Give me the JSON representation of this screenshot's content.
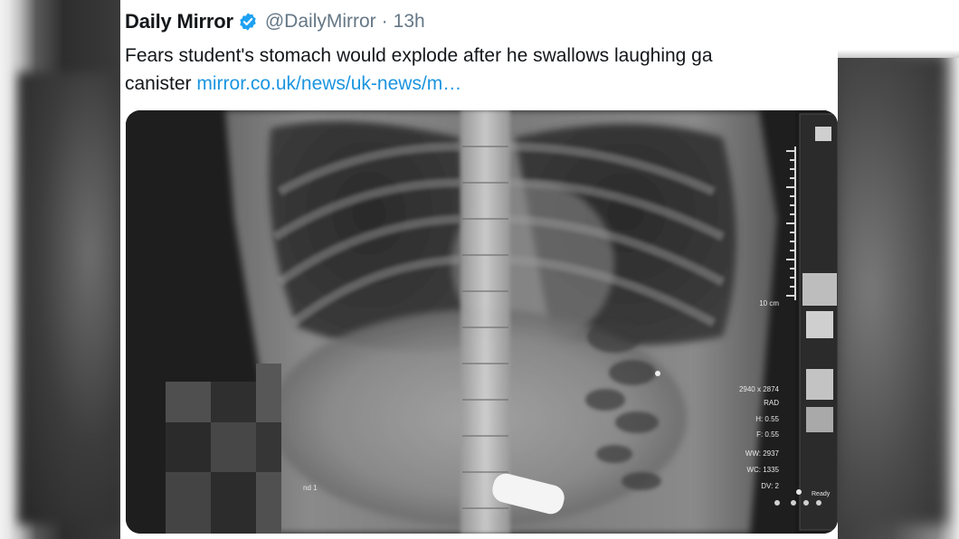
{
  "tweet": {
    "display_name": "Daily Mirror",
    "handle": "@DailyMirror",
    "separator": "·",
    "time": "13h",
    "text_line1": "Fears student's stomach would explode after he swallows laughing ga",
    "text_line2": "canister",
    "link_text": "mirror.co.uk/news/uk-news/m…"
  },
  "xray_overlay": {
    "size": "2940 x 2874",
    "mode": "RAD",
    "h": "H: 0.55",
    "f": "F: 0.55",
    "ww": "WW: 2937",
    "wc": "WC: 1335",
    "dv": "DV: 2",
    "scale_label": "10 cm",
    "ready": "Ready",
    "index": "nd 1"
  },
  "colors": {
    "link": "#1b95e0",
    "verified": "#1da1f2",
    "text": "#14171a",
    "muted": "#657786"
  }
}
